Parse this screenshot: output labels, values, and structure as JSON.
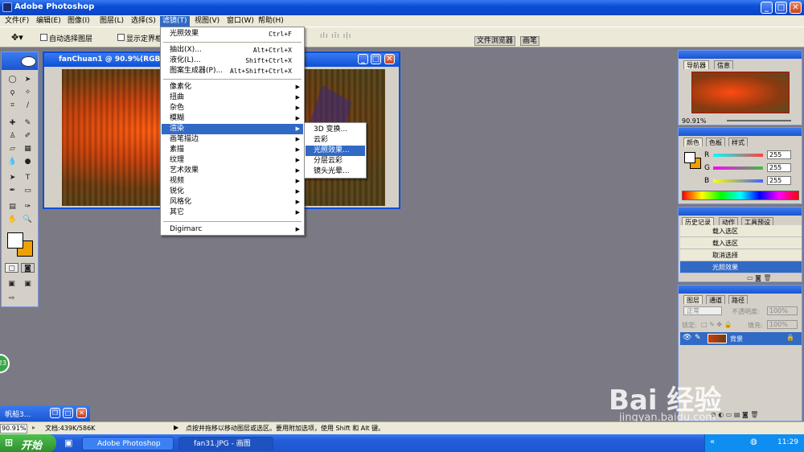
{
  "app": {
    "title": "Adobe Photoshop"
  },
  "menubar": {
    "items": [
      "文件(F)",
      "编辑(E)",
      "图像(I)",
      "图层(L)",
      "选择(S)",
      "滤镜(T)",
      "视图(V)",
      "窗口(W)",
      "帮助(H)"
    ],
    "active_index": 5
  },
  "options": {
    "auto_select": "自动选择图层",
    "show_bounds": "显示定界框",
    "file_browser_tab": "文件浏览器",
    "brushes_tab": "画笔"
  },
  "document": {
    "title": "fanChuan1 @ 90.9%(RGB)"
  },
  "filter_menu": {
    "items": [
      {
        "label": "光照效果",
        "shortcut": "Ctrl+F"
      },
      {
        "label": "抽出(X)...",
        "shortcut": "Alt+Ctrl+X"
      },
      {
        "label": "液化(L)...",
        "shortcut": "Shift+Ctrl+X"
      },
      {
        "label": "图案生成器(P)...",
        "shortcut": "Alt+Shift+Ctrl+X"
      },
      {
        "label": "像素化"
      },
      {
        "label": "扭曲"
      },
      {
        "label": "杂色"
      },
      {
        "label": "模糊"
      },
      {
        "label": "渲染"
      },
      {
        "label": "画笔描边"
      },
      {
        "label": "素描"
      },
      {
        "label": "纹理"
      },
      {
        "label": "艺术效果"
      },
      {
        "label": "视频"
      },
      {
        "label": "锐化"
      },
      {
        "label": "风格化"
      },
      {
        "label": "其它"
      },
      {
        "label": "Digimarc"
      }
    ],
    "highlighted": "渲染"
  },
  "render_submenu": {
    "items": [
      "3D 变换...",
      "云彩",
      "光照效果...",
      "分层云彩",
      "镜头光晕..."
    ],
    "highlighted_index": 2
  },
  "navigator": {
    "tabs": [
      "导航器",
      "信息"
    ],
    "zoom": "90.91%"
  },
  "color_panel": {
    "tabs": [
      "颜色",
      "色板",
      "样式"
    ],
    "labels": [
      "R",
      "G",
      "B"
    ],
    "values": [
      "255",
      "255",
      "255"
    ],
    "colors": {
      "r_track": "#ff4040",
      "g_track": "#40c040",
      "b_track": "#4060ff"
    }
  },
  "history_panel": {
    "tabs": [
      "历史记录",
      "动作",
      "工具预设"
    ],
    "items": [
      "载入选区",
      "载入选区",
      "取消选择",
      "光照效果"
    ],
    "selected_index": 3
  },
  "layers_panel": {
    "tabs": [
      "图层",
      "通道",
      "路径"
    ],
    "mode": "正常",
    "opacity_label": "不透明度:",
    "opacity": "100%",
    "lock_label": "锁定:",
    "fill_label": "填充:",
    "fill": "100%",
    "layer_name": "背景"
  },
  "minimized_doc": {
    "title": "帆船3..."
  },
  "status": {
    "zoom": "90.91%",
    "doc": "文档:439K/586K",
    "hint": "点按并拖移以移动图层或选区。要用附加选项，使用 Shift 和 Alt 键。"
  },
  "taskbar": {
    "start": "开始",
    "items": [
      "Adobe Photoshop",
      "fan31.JPG - 画图"
    ],
    "clock": "11:29"
  },
  "watermark": {
    "brand": "Bai 经验",
    "url": "jingyan.baidu.com"
  },
  "badge": "23"
}
